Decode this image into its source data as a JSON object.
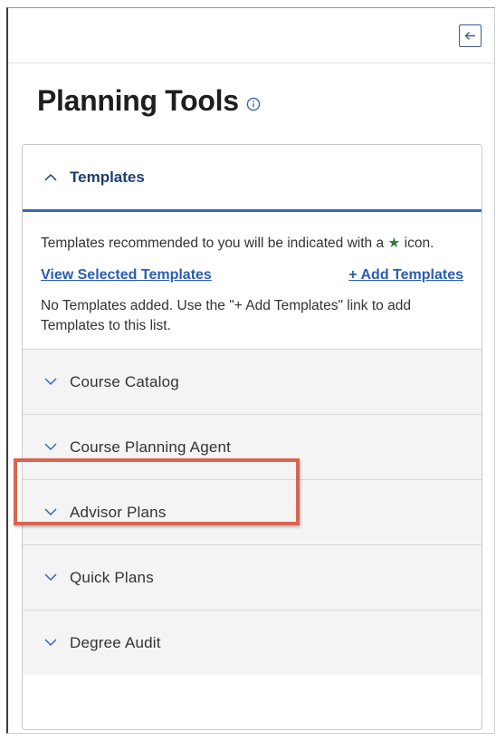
{
  "header": {
    "title": "Planning Tools",
    "collapse_icon": "arrow-left-icon",
    "info_icon": "info-circle-icon"
  },
  "templates": {
    "title": "Templates",
    "expanded": true,
    "description_part1": "Templates recommended to you will be indicated with a",
    "star_icon": "★",
    "description_part2": "icon.",
    "view_link": "View Selected Templates",
    "add_link": "+ Add Templates",
    "empty_message": "No Templates added. Use the \"+ Add Templates\" link to add Templates to this list."
  },
  "sections": [
    {
      "label": "Course Catalog"
    },
    {
      "label": "Course Planning Agent"
    },
    {
      "label": "Advisor Plans"
    },
    {
      "label": "Quick Plans"
    },
    {
      "label": "Degree Audit"
    }
  ],
  "colors": {
    "accent": "#3a66b0",
    "link": "#2a5db0",
    "highlight": "#d9644f",
    "star": "#2e7a3a"
  }
}
